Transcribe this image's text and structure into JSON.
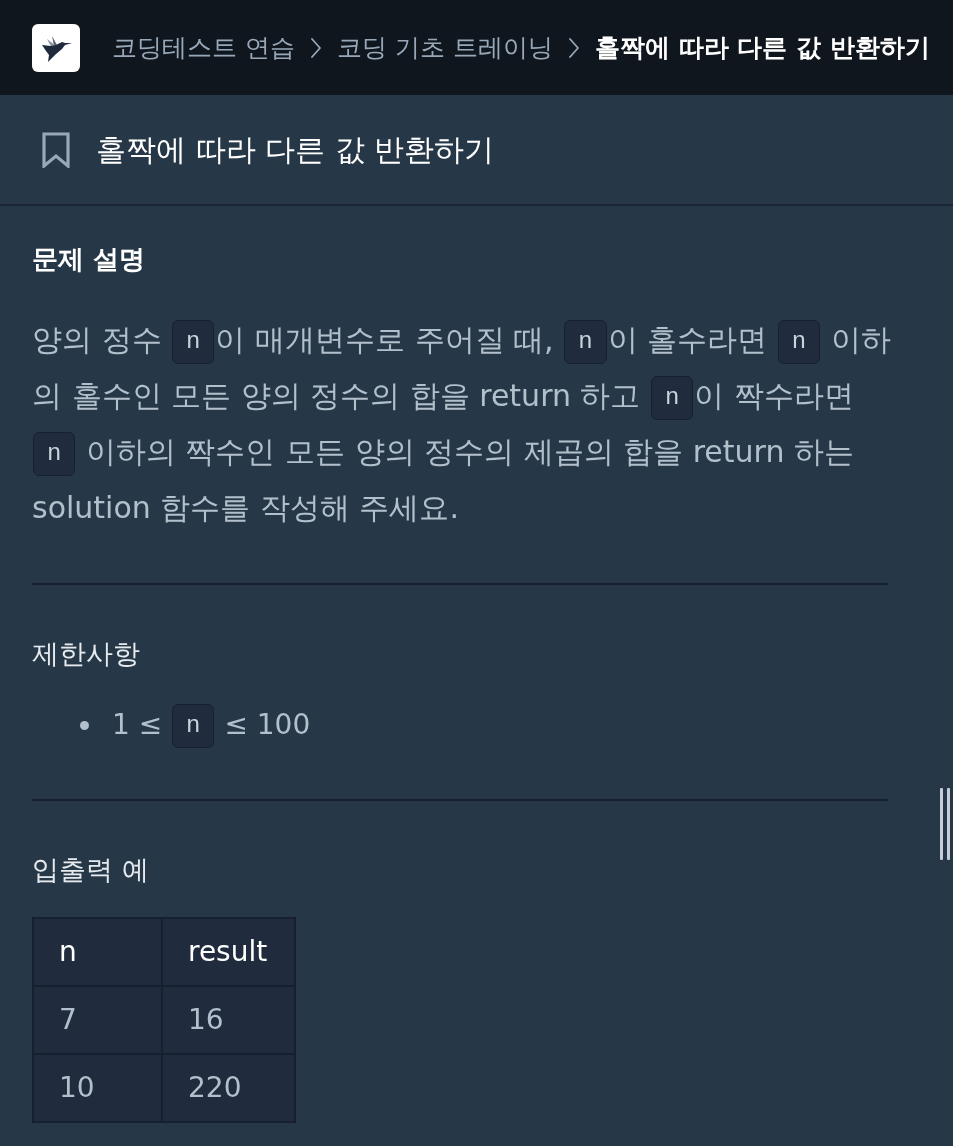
{
  "header": {
    "breadcrumbs": [
      {
        "label": "코딩테스트 연습",
        "current": false
      },
      {
        "label": "코딩 기초 트레이닝",
        "current": false
      },
      {
        "label": "홀짝에 따라 다른 값 반환하기",
        "current": true
      }
    ]
  },
  "title_bar": {
    "title": "홀짝에 따라 다른 값 반환하기"
  },
  "sections": [
    {
      "kind": "description",
      "heading": "문제 설명",
      "paragraph": [
        {
          "kind": "text",
          "text": "양의 정수 "
        },
        {
          "kind": "code",
          "text": "n"
        },
        {
          "kind": "text",
          "text": "이 매개변수로 주어질 때, "
        },
        {
          "kind": "code",
          "text": "n"
        },
        {
          "kind": "text",
          "text": "이 홀수라면 "
        },
        {
          "kind": "code",
          "text": "n"
        },
        {
          "kind": "text",
          "text": " 이하의 홀수인 모든 양의 정수의 합을 return 하고 "
        },
        {
          "kind": "code",
          "text": "n"
        },
        {
          "kind": "text",
          "text": "이 짝수라면 "
        },
        {
          "kind": "code",
          "text": "n"
        },
        {
          "kind": "text",
          "text": " 이하의 짝수인 모든 양의 정수의 제곱의 합을 return 하는 solution 함수를 작성해 주세요."
        }
      ]
    },
    {
      "kind": "constraints",
      "heading": "제한사항",
      "items": [
        [
          {
            "kind": "text",
            "text": "1 ≤ "
          },
          {
            "kind": "code",
            "text": "n"
          },
          {
            "kind": "text",
            "text": " ≤ 100"
          }
        ]
      ]
    },
    {
      "kind": "examples",
      "heading": "입출력 예",
      "table": {
        "columns": [
          "n",
          "result"
        ],
        "rows": [
          [
            "7",
            "16"
          ],
          [
            "10",
            "220"
          ]
        ]
      }
    }
  ]
}
